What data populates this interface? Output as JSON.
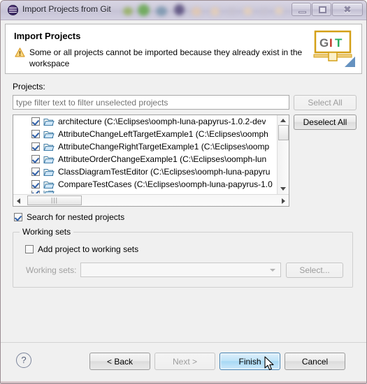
{
  "window": {
    "title": "Import Projects from Git",
    "icon": "git-repository-icon",
    "controls": {
      "minimize": "Minimize",
      "maximize": "Maximize",
      "close": "Close"
    }
  },
  "header": {
    "title": "Import Projects",
    "status_icon": "warning-icon",
    "message": "Some or all projects cannot be imported because they already exist in the workspace",
    "brand_logo": "git-logo",
    "brand_letters": [
      "G",
      "I",
      "T"
    ],
    "brand_colors": {
      "G": "#6f6f6f",
      "I": "#c0392b",
      "T": "#27ae60",
      "frame": "#d4a017"
    }
  },
  "main": {
    "projects_label": "Projects:",
    "filter": {
      "placeholder": "type filter text to filter unselected projects",
      "value": ""
    },
    "select_all_label": "Select All",
    "select_all_enabled": false,
    "deselect_all_label": "Deselect All",
    "deselect_all_enabled": true,
    "projects": [
      {
        "checked": true,
        "label": "architecture (C:\\Eclipses\\oomph-luna-papyrus-1.0.2-dev"
      },
      {
        "checked": true,
        "label": "AttributeChangeLeftTargetExample1 (C:\\Eclipses\\oomph"
      },
      {
        "checked": true,
        "label": "AttributeChangeRightTargetExample1 (C:\\Eclipses\\oomp"
      },
      {
        "checked": true,
        "label": "AttributeOrderChangeExample1 (C:\\Eclipses\\oomph-lun"
      },
      {
        "checked": true,
        "label": "ClassDiagramTestEditor (C:\\Eclipses\\oomph-luna-papyru"
      },
      {
        "checked": true,
        "label": "CompareTestCases (C:\\Eclipses\\oomph-luna-papyrus-1.0"
      }
    ],
    "nested_checkbox": {
      "label": "Search for nested projects",
      "checked": true
    }
  },
  "working_sets": {
    "group_title": "Working sets",
    "add_checkbox": {
      "label": "Add project to working sets",
      "checked": false
    },
    "combo_label": "Working sets:",
    "combo_value": "",
    "select_button": "Select...",
    "enabled": false
  },
  "footer": {
    "help_label": "?",
    "buttons": [
      {
        "label": "< Back",
        "enabled": true,
        "primary": false
      },
      {
        "label": "Next >",
        "enabled": false,
        "primary": false
      },
      {
        "label": "Finish",
        "enabled": true,
        "primary": true
      },
      {
        "label": "Cancel",
        "enabled": true,
        "primary": false
      }
    ]
  }
}
